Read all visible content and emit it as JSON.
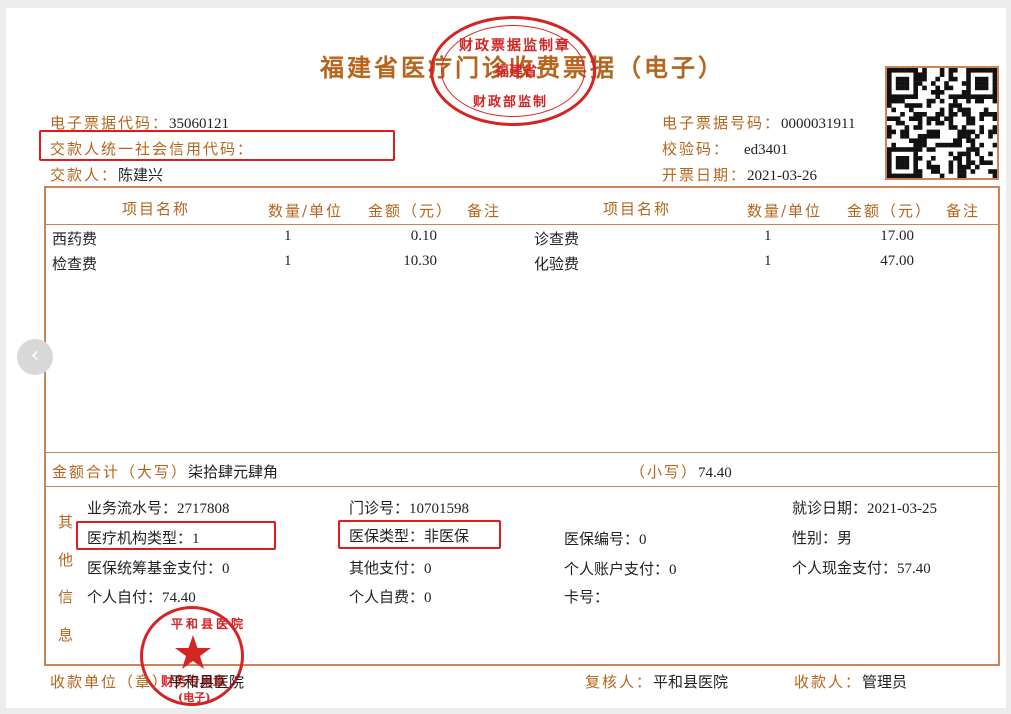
{
  "title": "福建省医疗门诊收费票据（电子）",
  "header": {
    "code_label": "电子票据代码：",
    "code_value": "35060121",
    "credit_label": "交款人统一社会信用代码：",
    "payer_label": "交款人：",
    "payer_value": "陈建兴",
    "number_label": "电子票据号码：",
    "number_value": "0000031911",
    "check_label": "校验码：",
    "check_value": "ed3401",
    "date_label": "开票日期：",
    "date_value": "2021-03-26"
  },
  "table": {
    "headers": [
      "项目名称",
      "数量/单位",
      "金额（元）",
      "备注",
      "项目名称",
      "数量/单位",
      "金额（元）",
      "备注"
    ],
    "rows": [
      {
        "name1": "西药费",
        "qty1": "1",
        "amt1": "0.10",
        "name2": "诊查费",
        "qty2": "1",
        "amt2": "17.00"
      },
      {
        "name1": "检查费",
        "qty1": "1",
        "amt1": "10.30",
        "name2": "化验费",
        "qty2": "1",
        "amt2": "47.00"
      }
    ]
  },
  "total": {
    "upper_label": "金额合计（大写）",
    "upper_value": "柒拾肆元肆角",
    "lower_label": "（小写）",
    "lower_value": "74.40"
  },
  "other": {
    "side_label": [
      "其",
      "他",
      "信",
      "息"
    ],
    "serial_label": "业务流水号：",
    "serial_value": "2717808",
    "clinic_label": "门诊号：",
    "clinic_value": "10701598",
    "visit_date_label": "就诊日期：",
    "visit_date_value": "2021-03-25",
    "inst_type_label": "医疗机构类型：",
    "inst_type_value": "1",
    "ins_type_label": "医保类型：",
    "ins_type_value": "非医保",
    "ins_no_label": "医保编号：",
    "ins_no_value": "0",
    "gender_label": "性别：",
    "gender_value": "男",
    "fund_label": "医保统筹基金支付：",
    "fund_value": "0",
    "other_pay_label": "其他支付：",
    "other_pay_value": "0",
    "account_label": "个人账户支付：",
    "account_value": "0",
    "cash_label": "个人现金支付：",
    "cash_value": "57.40",
    "self_pay_label": "个人自付：",
    "self_pay_value": "74.40",
    "self_cost_label": "个人自费：",
    "self_cost_value": "0",
    "card_label": "卡号："
  },
  "footer": {
    "unit_label": "收款单位（章）",
    "unit_value": "平和县医院",
    "reviewer_label": "复核人：",
    "reviewer_value": "平和县医院",
    "cashier_label": "收款人：",
    "cashier_value": "管理员"
  },
  "seals": {
    "top_outer": "财政票据监制章",
    "top_center": "福建省",
    "top_bottom": "财政部监制",
    "bottom_outer": "平和县医院",
    "bottom_center": "财务专用章",
    "bottom_sub": "(电子)"
  },
  "colors": {
    "label": "#b5651d",
    "border": "#c9845a",
    "highlight": "#e01b1b",
    "seal": "#d42424"
  }
}
